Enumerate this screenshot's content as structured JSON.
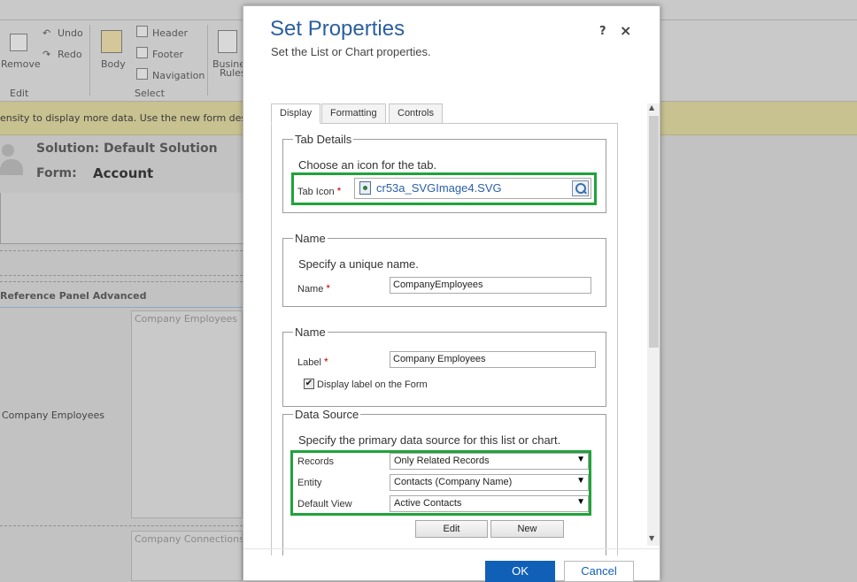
{
  "background": {
    "ribbon": {
      "remove_label": "Remove",
      "undo_label": "Undo",
      "redo_label": "Redo",
      "body_label": "Body",
      "header_label": "Header",
      "footer_label": "Footer",
      "navigation_label": "Navigation",
      "business_rules_label_1": "Busines",
      "business_rules_label_2": "Rules",
      "edit_group": "Edit",
      "select_group": "Select"
    },
    "notification": "ensity to display more data. Use the new form designer t",
    "solution_label": "Solution: Default Solution",
    "form_label": "Form:",
    "form_name": "Account",
    "section_title": "Reference Panel Advanced",
    "field_label": "Company Employees",
    "subgrid1": "Company Employees",
    "subgrid2": "Company Connections"
  },
  "dialog": {
    "title": "Set Properties",
    "subtitle": "Set the List or Chart properties.",
    "help": "?",
    "close": "×",
    "tabs": [
      {
        "label": "Display",
        "active": true
      },
      {
        "label": "Formatting",
        "active": false
      },
      {
        "label": "Controls",
        "active": false
      }
    ],
    "tab_details": {
      "legend": "Tab Details",
      "description": "Choose an icon for the tab.",
      "icon_label": "Tab Icon",
      "icon_value": "cr53a_SVGImage4.SVG"
    },
    "name_section": {
      "legend": "Name",
      "description": "Specify a unique name.",
      "label": "Name",
      "value": "CompanyEmployees"
    },
    "label_section": {
      "legend": "Name",
      "label": "Label",
      "value": "Company Employees",
      "checkbox_label": "Display label on the Form",
      "checkbox_mark": "✔"
    },
    "data_source": {
      "legend": "Data Source",
      "description": "Specify the primary data source for this list or chart.",
      "records_label": "Records",
      "records_value": "Only Related Records",
      "entity_label": "Entity",
      "entity_value": "Contacts (Company Name)",
      "view_label": "Default View",
      "view_value": "Active Contacts",
      "edit_btn": "Edit",
      "new_btn": "New"
    },
    "required_mark": "*",
    "ok": "OK",
    "cancel": "Cancel"
  },
  "colors": {
    "accent": "#1160b7",
    "title": "#2a5f9e",
    "highlight": "#1fa33a"
  }
}
